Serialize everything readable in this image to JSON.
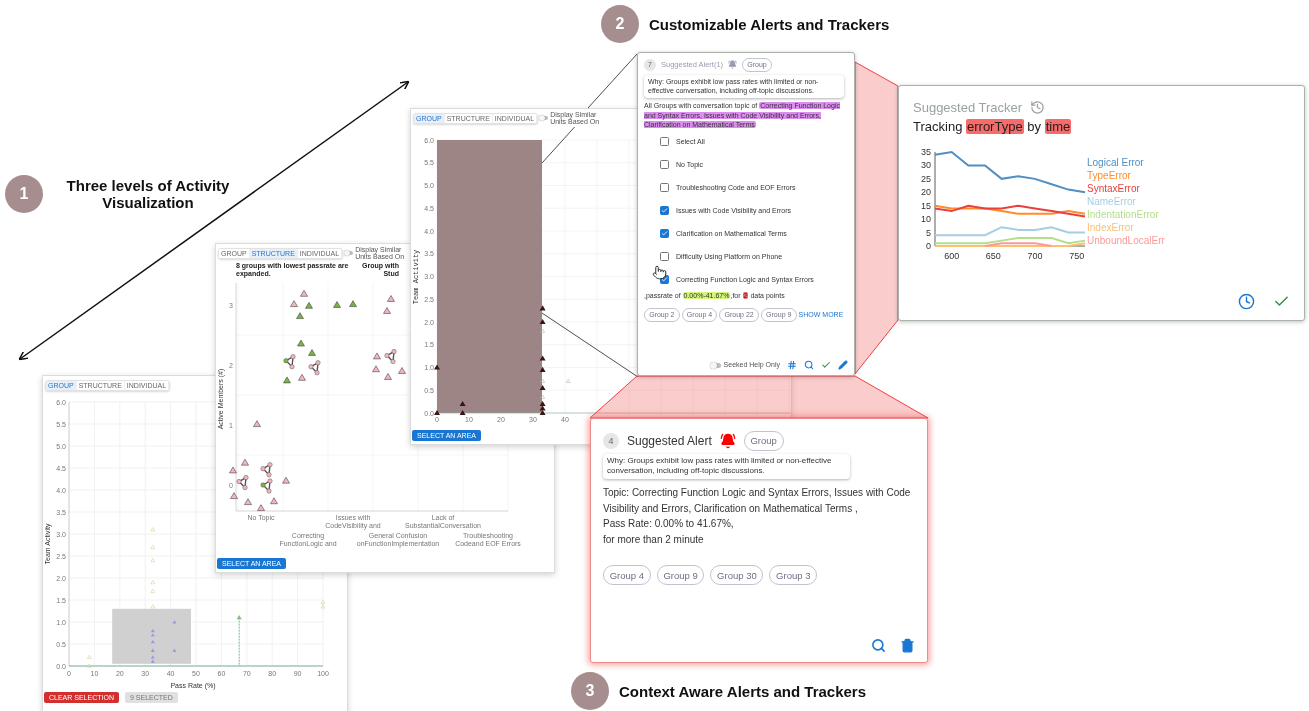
{
  "figure_labels": [
    {
      "number": "1",
      "text": "Three levels of Activity Visualization"
    },
    {
      "number": "2",
      "text": "Customizable Alerts and Trackers"
    },
    {
      "number": "3",
      "text": "Context Aware Alerts and Trackers"
    }
  ],
  "group_view": {
    "tabs": [
      {
        "label": "GROUP",
        "selected": true
      },
      {
        "label": "STRUCTURE",
        "selected": false
      },
      {
        "label": "INDIVIDUAL",
        "selected": false
      }
    ],
    "y_axis_label": "Team Activity",
    "x_axis_label": "Pass Rate (%)",
    "y_ticks": [
      "6.0",
      "5.5",
      "5.0",
      "4.5",
      "4.0",
      "3.5",
      "3.0",
      "2.5",
      "2.0",
      "1.5",
      "1.0",
      "0.5",
      "0.0"
    ],
    "x_ticks": [
      "0",
      "10",
      "20",
      "30",
      "40",
      "50",
      "60",
      "70",
      "80",
      "90",
      "100"
    ],
    "buttons": [
      {
        "label": "CLEAR SELECTION",
        "kind": "danger"
      },
      {
        "label": "9 SELECTED",
        "kind": "muted"
      }
    ]
  },
  "structure_view": {
    "tabs": [
      {
        "label": "GROUP",
        "selected": false
      },
      {
        "label": "STRUCTURE",
        "selected": true
      },
      {
        "label": "INDIVIDUAL",
        "selected": false
      }
    ],
    "toggle": {
      "label": "Display Similar Units Based On",
      "on": false
    },
    "heading": "8 groups with lowest passrate are expanded.",
    "heading_2": "Group with",
    "heading_3": "Stud",
    "y_axis_label": "Active Members (#)",
    "y_ticks": [
      "3",
      "2",
      "1",
      "0"
    ],
    "categories": [
      [
        "No Topic"
      ],
      [
        "Correcting",
        "FunctionLogic and"
      ],
      [
        "Issues with",
        "CodeVisibility and"
      ],
      [
        "General Confusion",
        "onFunctionImplementation"
      ],
      [
        "Lack of",
        "SubstantialConversation"
      ],
      [
        "Troubleshooting",
        "Codeand EOF Errors"
      ]
    ],
    "button": "SELECT AN AREA"
  },
  "zoomed_view": {
    "tabs": [
      {
        "label": "GROUP",
        "selected": true
      },
      {
        "label": "STRUCTURE",
        "selected": false
      },
      {
        "label": "INDIVIDUAL",
        "selected": false
      }
    ],
    "toggle": {
      "label": "Display Similar Units Based On",
      "on": false
    },
    "y_axis_label": "Team Activity",
    "y_ticks": [
      "6.0",
      "5.5",
      "5.0",
      "4.5",
      "4.0",
      "3.5",
      "3.0",
      "2.5",
      "2.0",
      "1.5",
      "1.0",
      "0.5",
      "0.0"
    ],
    "x_ticks": [
      "0",
      "10",
      "20",
      "30",
      "40"
    ],
    "button": "SELECT AN AREA"
  },
  "alert_editor": {
    "count": "7",
    "title": "Suggested Alert(1)",
    "tag": "Group",
    "why": "Why: Groups exhibit low pass rates with limited or non-effective conversation, including off-topic discussions.",
    "description": {
      "prefix": "All Groups with conversation topic of",
      "topic": "Correcting Function Logic and Syntax Errors, Issues with Code Visibility and Errors, Clarification on Mathematical Terms"
    },
    "options": [
      {
        "label": "Select All",
        "checked": false
      },
      {
        "label": "No Topic",
        "checked": false
      },
      {
        "label": "Troubleshooting Code and EOF Errors",
        "checked": false
      },
      {
        "label": "Issues with Code Visibility and Errors",
        "checked": true
      },
      {
        "label": "Clarification on Mathematical Terms",
        "checked": true
      },
      {
        "label": "Difficulty Using Platform on Phone",
        "checked": false
      },
      {
        "label": "Correcting Function Logic and Syntax Errors",
        "checked": true
      }
    ],
    "passrate": {
      "prefix": ",passrate of",
      "range": "0.00%-41.67%",
      "middle": ",for",
      "count": "2",
      "suffix": "data points"
    },
    "groups": [
      "Group 2",
      "Group 4",
      "Group 22",
      "Group 9"
    ],
    "show_more": "SHOW MORE",
    "seeked_toggle": {
      "label": "Seeked Help Only",
      "on": false
    }
  },
  "tracker": {
    "title": "Suggested Tracker",
    "tracking": {
      "prefix": "Tracking",
      "field": "errorType",
      "by": "by",
      "dimension": "time"
    },
    "chart_data": {
      "type": "line",
      "x": [
        580,
        600,
        620,
        640,
        660,
        680,
        700,
        720,
        740,
        760
      ],
      "xlim": [
        580,
        760
      ],
      "ylim": [
        0,
        35
      ],
      "xticks": [
        600,
        650,
        700,
        750
      ],
      "yticks": [
        0,
        5,
        10,
        15,
        20,
        25,
        30,
        35
      ],
      "series": [
        {
          "name": "Logical Error",
          "color": "#4f8fc4",
          "values": [
            34,
            35,
            30,
            30,
            25,
            26,
            25,
            23,
            21,
            20
          ]
        },
        {
          "name": "TypeError",
          "color": "#ff8c2a",
          "values": [
            15,
            14,
            14,
            14,
            13,
            12,
            12,
            12,
            13,
            12
          ]
        },
        {
          "name": "SyntaxError",
          "color": "#e8413c",
          "values": [
            14,
            13,
            15,
            14,
            14,
            15,
            14,
            13,
            12,
            11
          ]
        },
        {
          "name": "NameError",
          "color": "#a6cee3",
          "values": [
            4,
            4,
            4,
            4,
            7,
            6,
            6,
            7,
            5,
            5
          ]
        },
        {
          "name": "IndentationError",
          "color": "#b2df8a",
          "values": [
            1,
            1,
            1,
            1,
            2,
            3,
            3,
            3,
            1,
            2
          ]
        },
        {
          "name": "IndexError",
          "color": "#fdbf6f",
          "values": [
            0,
            0,
            0,
            0,
            0,
            0,
            0,
            0,
            0,
            1
          ]
        },
        {
          "name": "UnboundLocalErr",
          "color": "#fb9a99",
          "values": [
            null,
            null,
            null,
            0,
            1,
            1,
            1,
            0,
            null,
            null
          ]
        }
      ]
    }
  },
  "alert_card": {
    "count": "4",
    "title": "Suggested Alert",
    "tag": "Group",
    "why": "Why: Groups exhibit low pass rates with limited or non-effective conversation, including off-topic discussions.",
    "lines": [
      "Topic: Correcting Function Logic and Syntax Errors, Issues with Code Visibility and Errors, Clarification on Mathematical Terms ,",
      "Pass Rate: 0.00% to 41.67%,",
      "for more than 2 minute"
    ],
    "groups": [
      "Group 4",
      "Group 9",
      "Group 30",
      "Group 3"
    ]
  }
}
